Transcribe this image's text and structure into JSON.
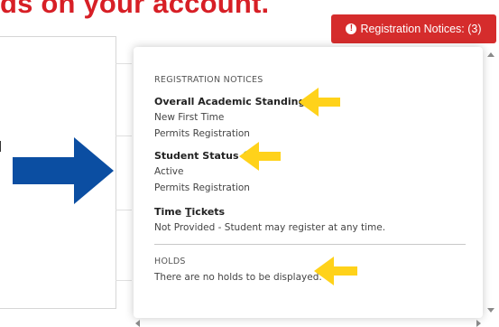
{
  "header": {
    "headline": "ds on your account."
  },
  "notices_button": {
    "icon": "info-icon",
    "label": "Registration Notices: (3)",
    "color": "#d52c2c"
  },
  "popover": {
    "registration_title": "REGISTRATION NOTICES",
    "items": [
      {
        "label": "Overall Academic Standing",
        "status_icon": "check-circle-icon",
        "lines": [
          "New First Time",
          "Permits Registration"
        ]
      },
      {
        "label": "Student Status",
        "status_icon": "check-circle-icon",
        "lines": [
          "Active",
          "Permits Registration"
        ]
      },
      {
        "label": "Time Tickets",
        "status_icon": "",
        "lines": [
          "Not Provided - Student may register at any time."
        ]
      }
    ],
    "holds_title": "HOLDS",
    "holds_text": "There are no holds to be displayed."
  },
  "annotations": {
    "yellow_arrow_color": "#ffd21a",
    "blue_arrow_color": "#0b4ea2"
  }
}
